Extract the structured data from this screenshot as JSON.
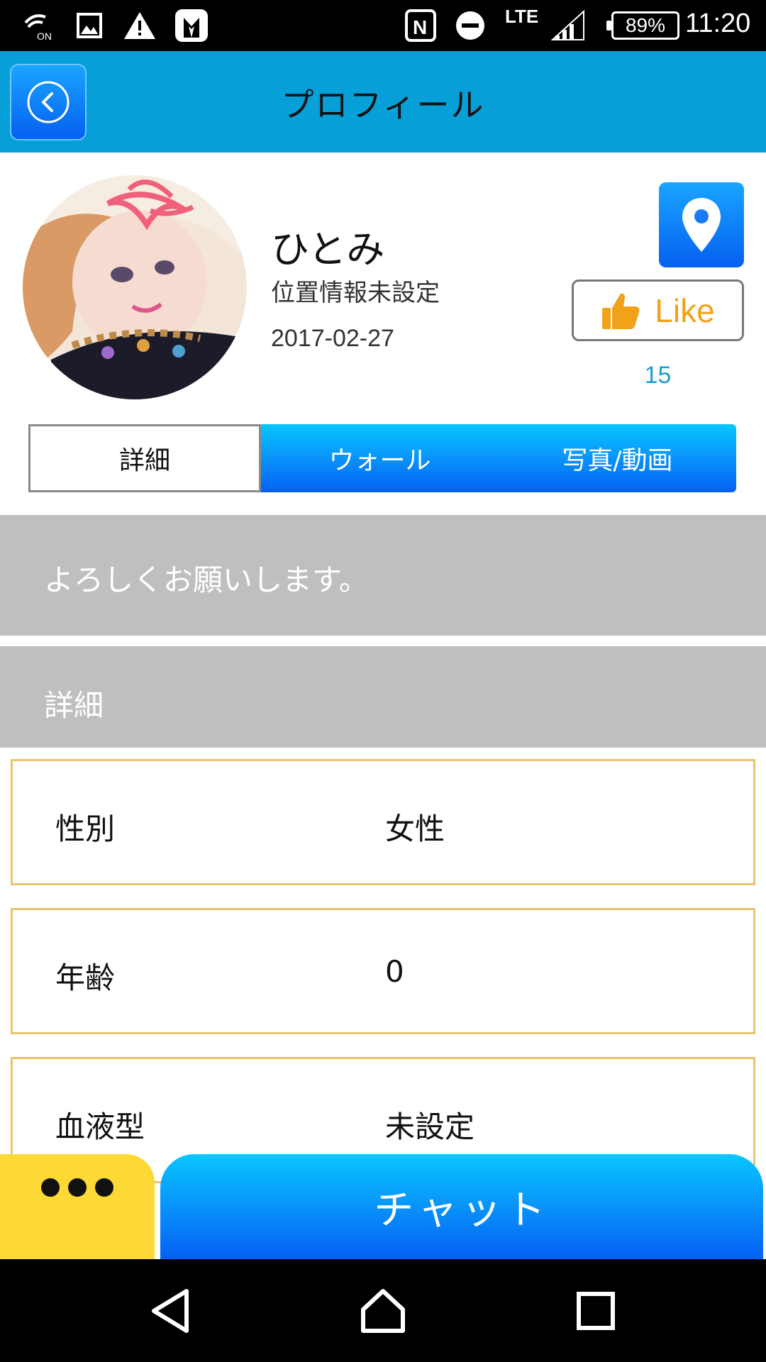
{
  "status_bar": {
    "time": "11:20",
    "battery": "89%",
    "network": "LTE",
    "nfc_label": "N",
    "icons": [
      "wifi-calling-on-icon",
      "image-icon",
      "warning-icon",
      "tuxedo-app-icon",
      "nfc-icon",
      "do-not-disturb-icon",
      "signal-icon",
      "battery-icon"
    ]
  },
  "header": {
    "title": "プロフィール",
    "back_icon": "chevron-left-icon"
  },
  "profile": {
    "name": "ひとみ",
    "location": "位置情報未設定",
    "date": "2017-02-27",
    "location_icon": "map-pin-icon",
    "like_label": "Like",
    "like_count": "15"
  },
  "tabs": [
    {
      "label": "詳細",
      "active": true
    },
    {
      "label": "ウォール",
      "active": false
    },
    {
      "label": "写真/動画",
      "active": false
    }
  ],
  "greeting": "よろしくお願いします。",
  "details": {
    "heading": "詳細",
    "rows": [
      {
        "label": "性別",
        "value": "女性"
      },
      {
        "label": "年齢",
        "value": "0"
      },
      {
        "label": "血液型",
        "value": "未設定"
      }
    ]
  },
  "actions": {
    "more_icon": "more-dots-icon",
    "chat_label": "チャット"
  },
  "colors": {
    "header_bg": "#079fd8",
    "accent_blue": "#0660f4",
    "section_gray": "#bfbfbf",
    "row_border": "#e8c471",
    "like_orange": "#f2a21a",
    "more_yellow": "#fdd935"
  }
}
